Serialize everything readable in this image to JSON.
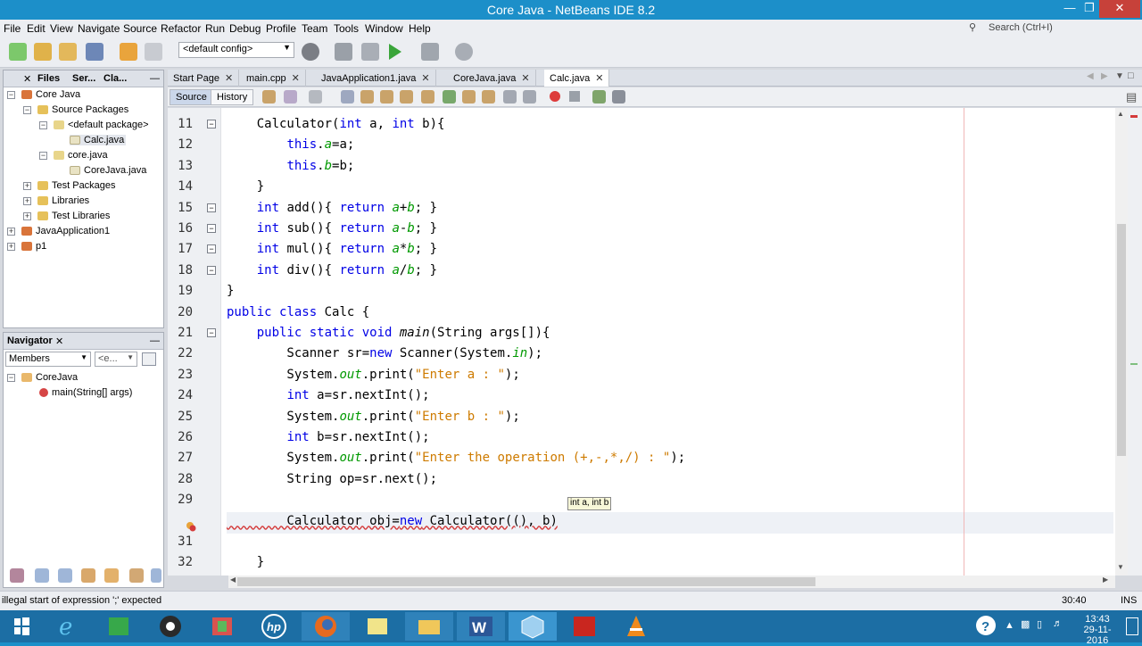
{
  "window": {
    "title": "Core Java - NetBeans IDE 8.2"
  },
  "menu": [
    "File",
    "Edit",
    "View",
    "Navigate",
    "Source",
    "Refactor",
    "Run",
    "Debug",
    "Profile",
    "Team",
    "Tools",
    "Window",
    "Help"
  ],
  "search": {
    "placeholder": "Search (Ctrl+I)"
  },
  "toolbar": {
    "config": "<default config>"
  },
  "projects_panel": {
    "tabs": [
      "Files",
      "Ser...",
      "Cla..."
    ],
    "tree": [
      {
        "label": "Core Java",
        "icon": "project-icon"
      },
      {
        "label": "Source Packages",
        "icon": "folder-icon"
      },
      {
        "label": "<default package>",
        "icon": "package-icon"
      },
      {
        "label": "Calc.java",
        "icon": "java-file-icon"
      },
      {
        "label": "core.java",
        "icon": "package-icon"
      },
      {
        "label": "CoreJava.java",
        "icon": "java-file-icon"
      },
      {
        "label": "Test Packages",
        "icon": "folder-icon"
      },
      {
        "label": "Libraries",
        "icon": "library-icon"
      },
      {
        "label": "Test Libraries",
        "icon": "library-icon"
      },
      {
        "label": "JavaApplication1",
        "icon": "project-icon"
      },
      {
        "label": "p1",
        "icon": "project-icon"
      }
    ]
  },
  "navigator": {
    "title": "Navigator",
    "filter": "Members",
    "filter2": "<e...",
    "items": [
      {
        "label": "CoreJava",
        "icon": "class-icon"
      },
      {
        "label": "main(String[] args)",
        "icon": "method-icon"
      }
    ]
  },
  "editor": {
    "tabs": [
      "Start Page",
      "main.cpp",
      "JavaApplication1.java",
      "CoreJava.java",
      "Calc.java"
    ],
    "active_tab": "Calc.java",
    "view_buttons": [
      "Source",
      "History"
    ],
    "lines": [
      {
        "n": "11",
        "fold": "−",
        "html": "    <span class=\"kw\"></span>Calculator(<span class=\"kw\">int</span> a, <span class=\"kw\">int</span> b){"
      },
      {
        "n": "12",
        "fold": "",
        "html": "        <span class=\"kw\">this</span>.<span class=\"fld\">a</span>=a;"
      },
      {
        "n": "13",
        "fold": "",
        "html": "        <span class=\"kw\">this</span>.<span class=\"fld\">b</span>=b;"
      },
      {
        "n": "14",
        "fold": "",
        "html": "    }"
      },
      {
        "n": "15",
        "fold": "−",
        "html": "    <span class=\"kw\">int</span> add(){ <span class=\"kw\">return</span> <span class=\"fld\">a</span>+<span class=\"fld\">b</span>; }"
      },
      {
        "n": "16",
        "fold": "−",
        "html": "    <span class=\"kw\">int</span> sub(){ <span class=\"kw\">return</span> <span class=\"fld\">a</span>-<span class=\"fld\">b</span>; }"
      },
      {
        "n": "17",
        "fold": "−",
        "html": "    <span class=\"kw\">int</span> mul(){ <span class=\"kw\">return</span> <span class=\"fld\">a</span>*<span class=\"fld\">b</span>; }"
      },
      {
        "n": "18",
        "fold": "−",
        "html": "    <span class=\"kw\">int</span> div(){ <span class=\"kw\">return</span> <span class=\"fld\">a</span>/<span class=\"fld\">b</span>; }"
      },
      {
        "n": "19",
        "fold": "",
        "html": "}"
      },
      {
        "n": "20",
        "fold": "",
        "html": "<span class=\"kw\">public class</span> Calc {"
      },
      {
        "n": "21",
        "fold": "−",
        "html": "    <span class=\"kw\">public static void</span> <span class=\"it\">main</span>(String args[]){"
      },
      {
        "n": "22",
        "fold": "",
        "html": "        Scanner sr=<span class=\"kw\">new</span> Scanner(System.<span class=\"fld\">in</span>);"
      },
      {
        "n": "23",
        "fold": "",
        "html": "        System.<span class=\"fld\">out</span>.print(<span class=\"str\">\"Enter a : \"</span>);"
      },
      {
        "n": "24",
        "fold": "",
        "html": "        <span class=\"kw\">int</span> a=sr.nextInt();"
      },
      {
        "n": "25",
        "fold": "",
        "html": "        System.<span class=\"fld\">out</span>.print(<span class=\"str\">\"Enter b : \"</span>);"
      },
      {
        "n": "26",
        "fold": "",
        "html": "        <span class=\"kw\">int</span> b=sr.nextInt();"
      },
      {
        "n": "27",
        "fold": "",
        "html": "        System.<span class=\"fld\">out</span>.print(<span class=\"str\">\"Enter the operation (+,-,*,/) : \"</span>);"
      },
      {
        "n": "28",
        "fold": "",
        "html": "        String op=sr.next();"
      },
      {
        "n": "29",
        "fold": "",
        "html": ""
      },
      {
        "n": "",
        "fold": "",
        "html": "        Calculator obj=<span class=\"kw\">new</span> Calculator((), b)"
      },
      {
        "n": "31",
        "fold": "",
        "html": ""
      },
      {
        "n": "32",
        "fold": "",
        "html": "    }"
      }
    ],
    "tooltip": "int a, int b"
  },
  "status": {
    "message": "illegal start of expression ';' expected",
    "position": "30:40",
    "mode": "INS"
  },
  "taskbar": {
    "time": "13:43",
    "date": "29-11-2016"
  },
  "colors": {
    "titlebar": "#1c8fc9",
    "keyword": "#0000e6",
    "string": "#ce7b00",
    "field": "#009900",
    "close": "#c7413a"
  }
}
